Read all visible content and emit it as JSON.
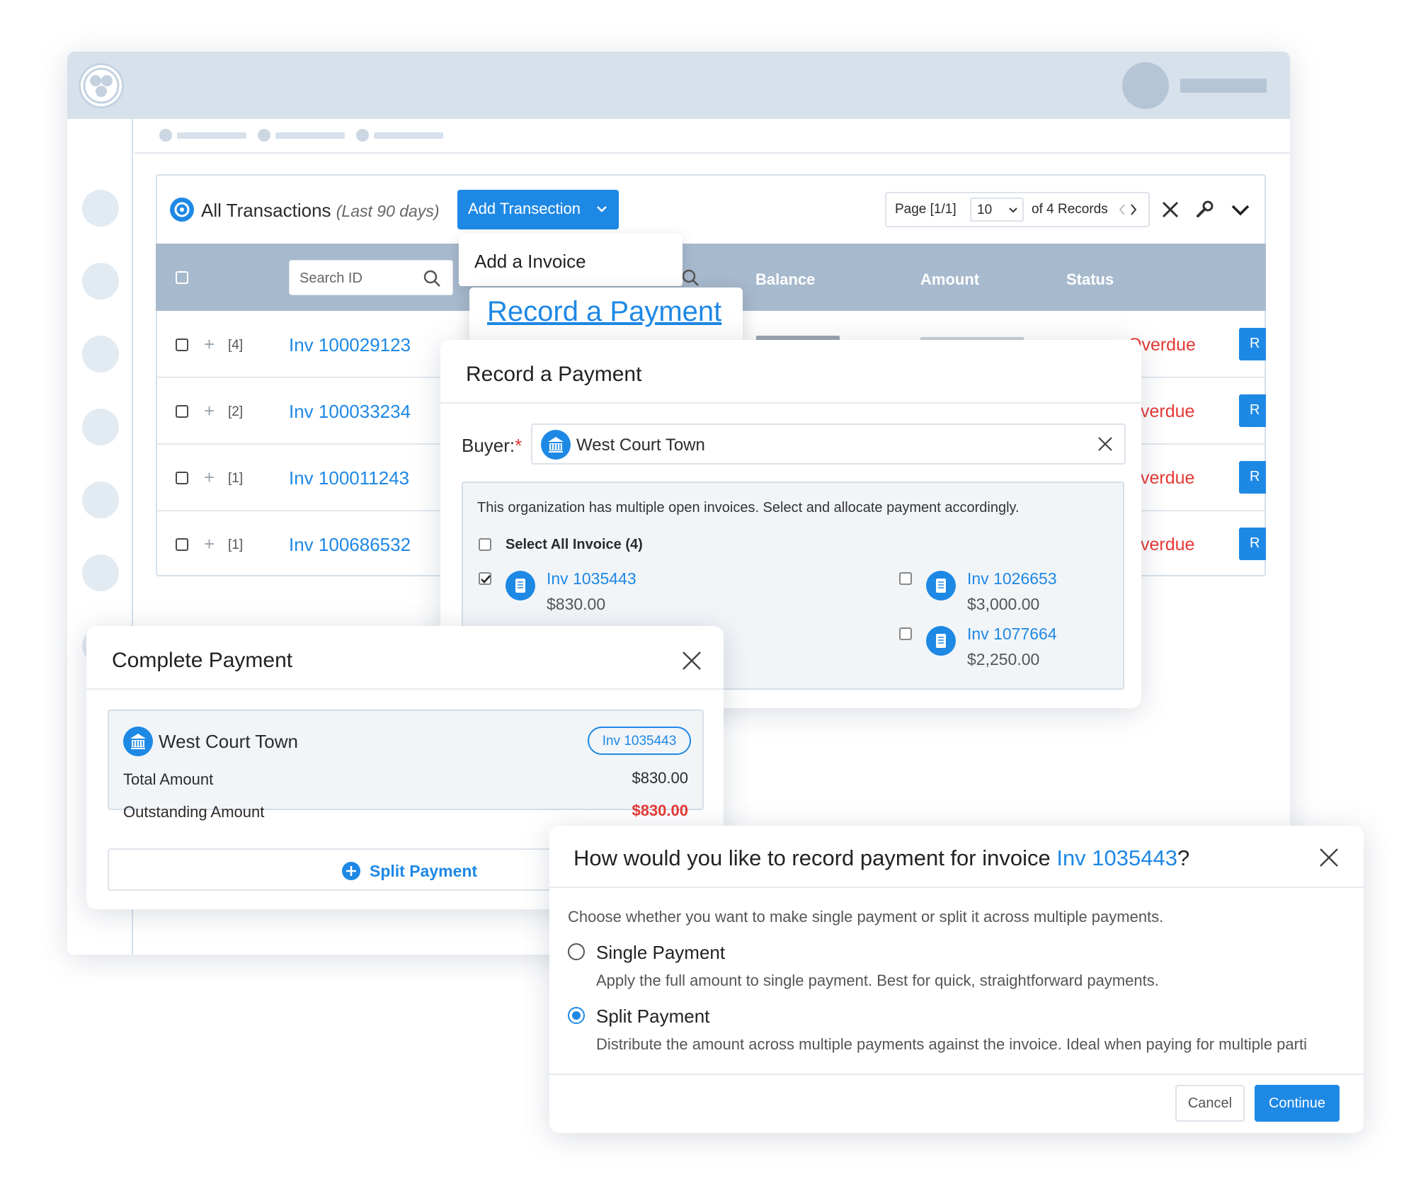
{
  "transactions": {
    "title": "All Transactions",
    "subtitle": "(Last 90 days)",
    "add_button": "Add Transection",
    "dropdown": {
      "add_invoice": "Add a Invoice",
      "record_payment": "Record a Payment"
    },
    "pagination": {
      "page": "Page [1/1]",
      "per_page": "10",
      "records": "of 4 Records"
    },
    "search_placeholder": "Search ID",
    "columns": {
      "balance": "Balance",
      "amount": "Amount",
      "status": "Status"
    },
    "rows": [
      {
        "count": "[4]",
        "invoice": "Inv 100029123",
        "status": "Overdue"
      },
      {
        "count": "[2]",
        "invoice": "Inv 100033234",
        "status": "verdue"
      },
      {
        "count": "[1]",
        "invoice": "Inv 100011243",
        "status": "verdue"
      },
      {
        "count": "[1]",
        "invoice": "Inv 100686532",
        "status": "verdue"
      }
    ],
    "row_button": "R"
  },
  "record_payment": {
    "title": "Record a Payment",
    "buyer_label": "Buyer:",
    "required_mark": "*",
    "buyer_value": "West Court Town",
    "notice": "This organization has multiple open invoices. Select and allocate payment accordingly.",
    "select_all": "Select All Invoice (4)",
    "invoices": [
      {
        "id": "Inv 1035443",
        "amount": "$830.00",
        "checked": true
      },
      {
        "id": "Inv 1026653",
        "amount": "$3,000.00",
        "checked": false
      },
      {
        "id": "Inv 1077664",
        "amount": "$2,250.00",
        "checked": false
      }
    ]
  },
  "complete_payment": {
    "title": "Complete Payment",
    "buyer": "West Court Town",
    "invoice_badge": "Inv 1035443",
    "total_label": "Total Amount",
    "total_value": "$830.00",
    "outstanding_label": "Outstanding Amount",
    "outstanding_value": "$830.00",
    "split_button": "Split Payment"
  },
  "record_method": {
    "title_prefix": "How would you like to record payment for invoice ",
    "title_invoice": "Inv 1035443",
    "title_suffix": "?",
    "description": "Choose whether you want to make single payment or split it across multiple payments.",
    "options": [
      {
        "label": "Single Payment",
        "help": "Apply the full amount to single payment. Best for quick, straightforward payments.",
        "selected": false
      },
      {
        "label": "Split Payment",
        "help": "Distribute the amount across multiple payments against the invoice. Ideal when paying for multiple parti",
        "selected": true
      }
    ],
    "cancel": "Cancel",
    "continue": "Continue"
  },
  "colors": {
    "accent": "#1e88e5",
    "danger": "#e53935",
    "chrome": "#d6e1ec",
    "table_header": "#a7b9cd"
  }
}
